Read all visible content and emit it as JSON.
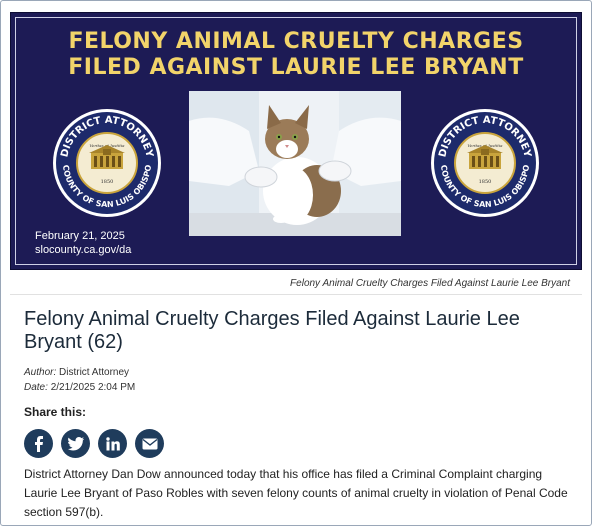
{
  "banner": {
    "title_line1": "FELONY ANIMAL CRUELTY CHARGES",
    "title_line2": "FILED AGAINST LAURIE LEE BRYANT",
    "date": "February 21, 2025",
    "url": "slocounty.ca.gov/da",
    "seal_top_text": "DISTRICT ATTORNEY",
    "seal_bottom_text": "COUNTY OF SAN LUIS OBISPO",
    "seal_motto": "Veritas et Justitia",
    "seal_year": "1850",
    "navy": "#1d1b55",
    "gold": "#f2d46a"
  },
  "caption": "Felony Animal Cruelty Charges Filed Against Laurie Lee Bryant",
  "article": {
    "headline": "Felony Animal Cruelty Charges Filed Against Laurie Lee Bryant (62)",
    "author_label": "Author:",
    "author": "District Attorney",
    "date_label": "Date:",
    "date": "2/21/2025 2:04 PM",
    "share_label": "Share this:",
    "share_buttons": [
      "facebook-icon",
      "twitter-icon",
      "linkedin-icon",
      "email-icon"
    ],
    "body": "District Attorney Dan Dow announced today that his office has filed a Criminal Complaint charging Laurie Lee Bryant of Paso Robles with seven felony counts of animal cruelty in violation of Penal Code section 597(b)."
  }
}
